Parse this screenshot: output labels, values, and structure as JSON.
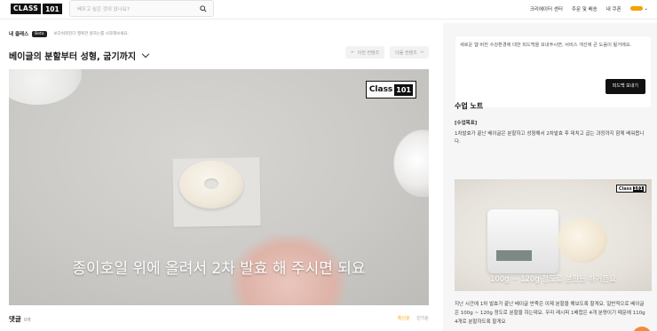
{
  "header": {
    "logo": {
      "part1": "CLASS",
      "part2": "101"
    },
    "search": {
      "placeholder": "배우고 싶은 것이 있나요?"
    },
    "nav": [
      "크리에이터 센터",
      "주문 및 배송",
      "내 쿠폰"
    ],
    "brand_color": "#f4a300"
  },
  "main": {
    "my_class": "내 클래스",
    "beta": "Beta",
    "description": "보다쉬워진다 행복한 원하는를 시작해보세요.",
    "title": "베이글의 분할부터 성형, 굽기까지",
    "prev_label": "이전 컨텐츠",
    "next_label": "다음 컨텐츠",
    "video": {
      "watermark": {
        "part1": "Class",
        "part2": "101"
      },
      "subtitle": "종이호일 위에 올려서 2차 발효 해 주시면 되요"
    },
    "comments": {
      "title": "댓글",
      "count": "0개",
      "sort_latest": "최신순",
      "sort_popular": "인기순"
    }
  },
  "sidebar": {
    "feedback": {
      "text": "새로운 웹 버전 수강환경에 대한 피드백을 보내주시면, 서비스 개선에 큰 도움이 될거에요.",
      "button": "피드백 보내기"
    },
    "notes_title": "수업 노트",
    "goal_header": "[수업목표]",
    "goal_text": "1차발효가 끝난 베이글은 분할하고 성형해서 2차발효 후 데치고 굽는 과정까지 함께 배워봅니다.",
    "thumbnail": {
      "watermark": {
        "part1": "Class",
        "part2": "101"
      },
      "subtitle": "100g ~ 120g 정도로 분할을 하거든요"
    },
    "body_text": "지난 시간에 1차 발효가 끝난 베이글 반죽은 이제 분할을 해보도록 할게요. 일반적으로 베이글은 100g ~ 120g 정도로 분할을 하는데요. 우리 레시피 1배합은 4개 분량이기 때문에 110g 4개로 분할하도록 할게요"
  }
}
